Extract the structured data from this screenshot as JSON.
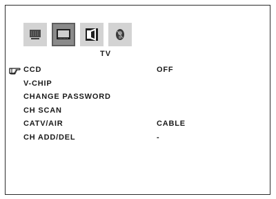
{
  "menu": {
    "title": "TV",
    "icons": [
      {
        "name": "picture-icon",
        "selected": false
      },
      {
        "name": "tv-icon",
        "selected": true
      },
      {
        "name": "speaker-icon",
        "selected": false
      },
      {
        "name": "setup-icon",
        "selected": false
      }
    ],
    "items": [
      {
        "label": "CCD",
        "value": "OFF"
      },
      {
        "label": "V-CHIP",
        "value": ""
      },
      {
        "label": "CHANGE PASSWORD",
        "value": ""
      },
      {
        "label": "CH SCAN",
        "value": ""
      },
      {
        "label": "CATV/AIR",
        "value": "CABLE"
      },
      {
        "label": "CH ADD/DEL",
        "value": "-"
      }
    ],
    "selected_index": 0
  },
  "colors": {
    "tab_bg": "#d3d3d3",
    "tab_selected_bg": "#8a8a8a",
    "text": "#1a1a1a"
  }
}
